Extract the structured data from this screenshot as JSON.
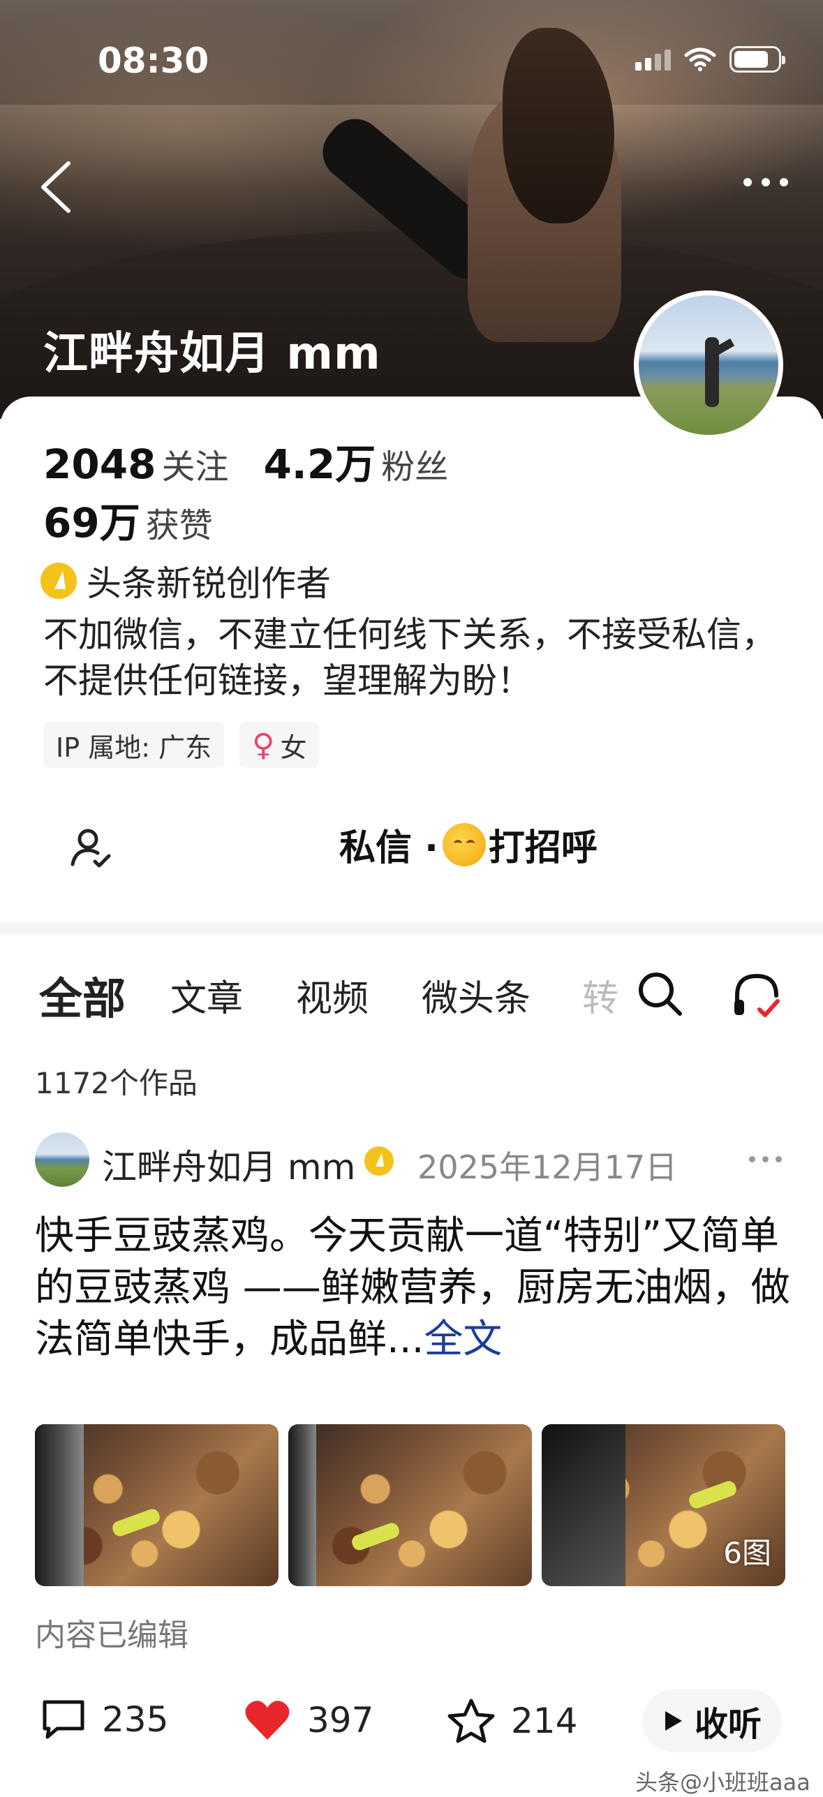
{
  "status": {
    "time": "08:30"
  },
  "profile": {
    "name": "江畔舟如月 mm",
    "following_count": "2048",
    "following_label": "关注",
    "followers_count": "4.2万",
    "followers_label": "粉丝",
    "likes_count": "69万",
    "likes_label": "获赞",
    "badge": "头条新锐创作者",
    "bio": "不加微信，不建立任何线下关系，不接受私信，不提供任何链接，望理解为盼！",
    "ip_location": "IP 属地: 广东",
    "gender_symbol": "♀",
    "gender": "女"
  },
  "actions": {
    "message_prefix": "私信 ·",
    "message_greet": "打招呼"
  },
  "tabs": [
    {
      "label": "全部",
      "active": true
    },
    {
      "label": "文章"
    },
    {
      "label": "视频"
    },
    {
      "label": "微头条"
    },
    {
      "label": "转"
    }
  ],
  "works_count": "1172个作品",
  "post": {
    "author": "江畔舟如月 mm",
    "date": "2025年12月17日",
    "text": "快手豆豉蒸鸡。今天贡献一道“特别”又简单的豆豉蒸鸡 ——鲜嫩营养，厨房无油烟，做法简单快手，成品鲜...",
    "more_label": "全文",
    "image_count": "6图",
    "edited_note": "内容已编辑",
    "comments": "235",
    "likes": "397",
    "favorites": "214",
    "listen_label": "收听"
  },
  "watermark": "头条@小班班aaa",
  "colors": {
    "accent_like": "#e8262d",
    "link": "#1a3d9a",
    "badge": "#f4c21a",
    "female": "#e6466a"
  }
}
